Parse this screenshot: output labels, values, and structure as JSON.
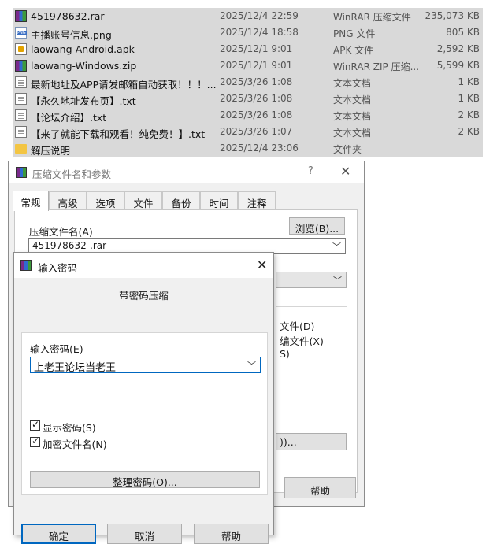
{
  "files": [
    {
      "name": "451978632.rar",
      "date": "2025/12/4 22:59",
      "type": "WinRAR 压缩文件",
      "size": "235,073 KB",
      "icon": "rar-icon"
    },
    {
      "name": "主播账号信息.png",
      "date": "2025/12/4 18:58",
      "type": "PNG 文件",
      "size": "805 KB",
      "icon": "png-icon"
    },
    {
      "name": "laowang-Android.apk",
      "date": "2025/12/1 9:01",
      "type": "APK 文件",
      "size": "2,592 KB",
      "icon": "apk-icon"
    },
    {
      "name": "laowang-Windows.zip",
      "date": "2025/12/1 9:01",
      "type": "WinRAR ZIP 压缩...",
      "size": "5,599 KB",
      "icon": "rar-icon"
    },
    {
      "name": "最新地址及APP请发邮箱自动获取！！！....",
      "date": "2025/3/26 1:08",
      "type": "文本文档",
      "size": "1 KB",
      "icon": "txt-icon"
    },
    {
      "name": "【永久地址发布页】.txt",
      "date": "2025/3/26 1:08",
      "type": "文本文档",
      "size": "1 KB",
      "icon": "txt-icon"
    },
    {
      "name": "【论坛介绍】.txt",
      "date": "2025/3/26 1:08",
      "type": "文本文档",
      "size": "2 KB",
      "icon": "txt-icon"
    },
    {
      "name": "【来了就能下载和观看！纯免费！】.txt",
      "date": "2025/3/26 1:07",
      "type": "文本文档",
      "size": "2 KB",
      "icon": "txt-icon"
    },
    {
      "name": "解压说明",
      "date": "2025/12/4 23:06",
      "type": "文件夹",
      "size": "",
      "icon": "folder-icon"
    }
  ],
  "archive_dialog": {
    "title": "压缩文件名和参数",
    "help": "?",
    "close": "✕",
    "tabs": [
      "常规",
      "高级",
      "选项",
      "文件",
      "备份",
      "时间",
      "注释"
    ],
    "archive_name_label": "压缩文件名(A)",
    "browse_label": "浏览(B)...",
    "archive_name_value": "451978632-.rar",
    "partial_option_1": "文件(D)",
    "partial_option_2": "编文件(X)",
    "partial_option_3": "S)",
    "partial_button": "))...",
    "help_button": "帮助"
  },
  "password_dialog": {
    "title": "输入密码",
    "close": "✕",
    "heading": "带密码压缩",
    "password_label": "输入密码(E)",
    "password_value": "上老王论坛当老王",
    "show_password_label": "显示密码(S)",
    "encrypt_names_label": "加密文件名(N)",
    "organize_button": "整理密码(O)...",
    "ok_button": "确定",
    "cancel_button": "取消",
    "help_button": "帮助"
  }
}
